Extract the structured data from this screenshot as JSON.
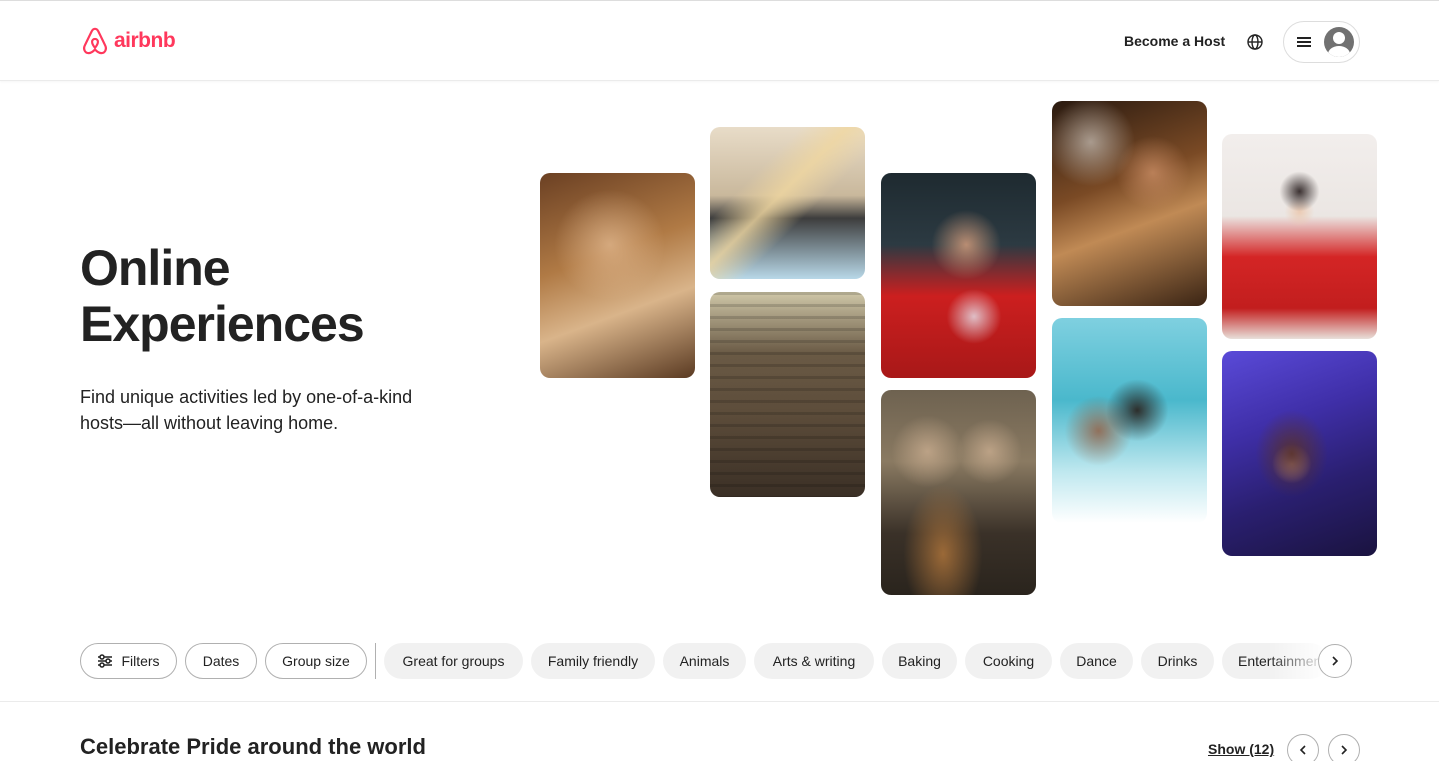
{
  "header": {
    "logo_text": "airbnb",
    "become_host": "Become a Host"
  },
  "hero": {
    "title_line1": "Online",
    "title_line2": "Experiences",
    "subtitle": "Find unique activities led by one-of-a-kind hosts—all without leaving home."
  },
  "filters": {
    "buttons": [
      "Filters",
      "Dates",
      "Group size"
    ],
    "categories": [
      "Great for groups",
      "Family friendly",
      "Animals",
      "Arts & writing",
      "Baking",
      "Cooking",
      "Dance",
      "Drinks",
      "Entertainment"
    ]
  },
  "section": {
    "title": "Celebrate Pride around the world",
    "show_link": "Show (12)"
  },
  "colors": {
    "brand": "#FF385C",
    "text": "#222222",
    "pill_fill": "#F1F1F1"
  }
}
